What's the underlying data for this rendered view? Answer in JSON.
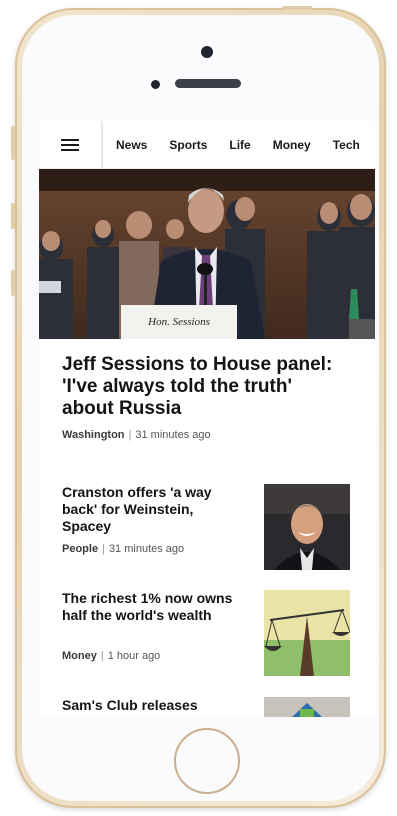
{
  "nav": {
    "items": [
      "News",
      "Sports",
      "Life",
      "Money",
      "Tech"
    ]
  },
  "hero": {
    "nameplate": "Hon. Sessions"
  },
  "top_story": {
    "headline": "Jeff Sessions to House panel: 'I've always told the truth' about Russia",
    "section": "Washington",
    "time": "31 minutes ago"
  },
  "stories": [
    {
      "headline": "Cranston offers 'a way back' for Weinstein, Spacey",
      "section": "People",
      "time": "31 minutes ago"
    },
    {
      "headline": "The richest 1% now owns half the world's wealth",
      "section": "Money",
      "time": "1 hour ago"
    },
    {
      "headline": "Sam's Club releases",
      "section": "",
      "time": ""
    }
  ],
  "colors": {
    "phone_gold": "#e6d2b0",
    "text": "#141414",
    "meta": "#555555"
  }
}
